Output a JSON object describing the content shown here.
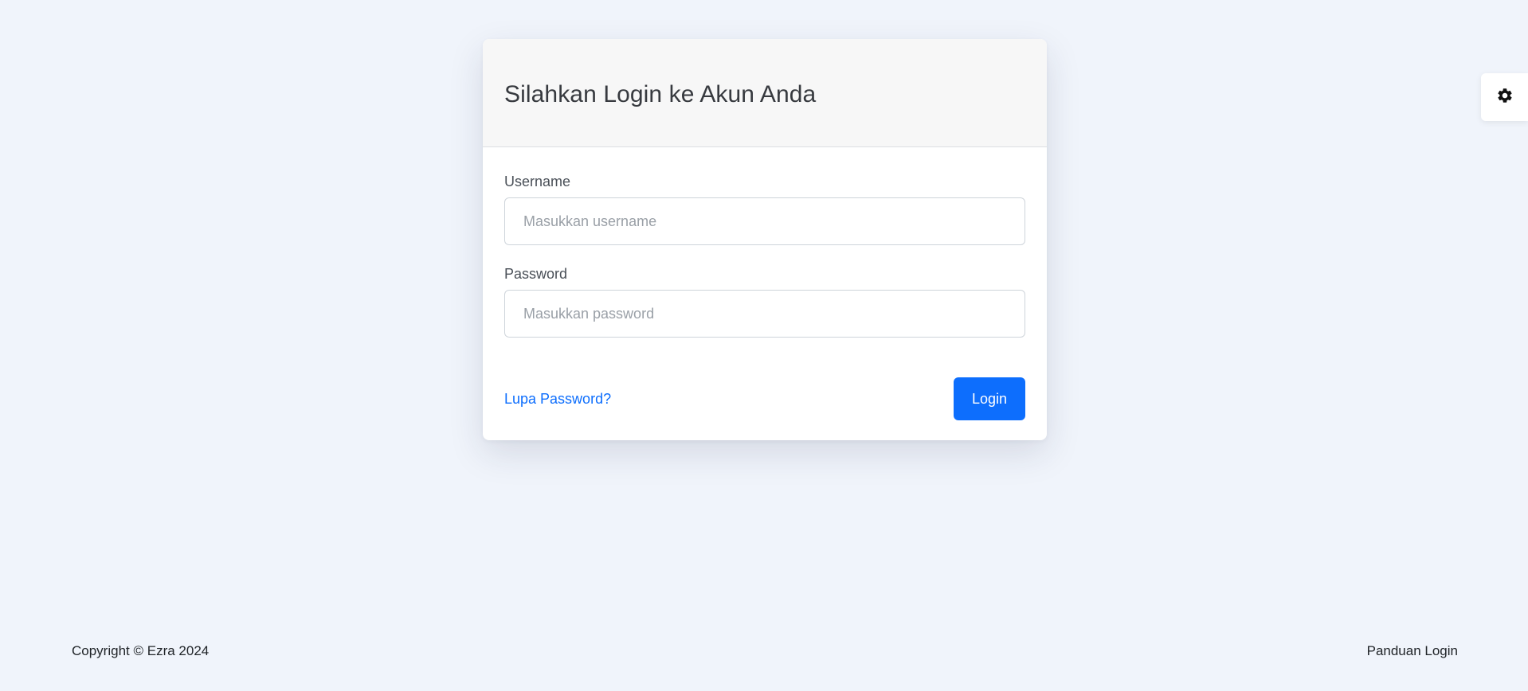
{
  "login_card": {
    "title": "Silahkan Login ke Akun Anda",
    "username": {
      "label": "Username",
      "placeholder": "Masukkan username",
      "value": ""
    },
    "password": {
      "label": "Password",
      "placeholder": "Masukkan password",
      "value": ""
    },
    "forgot_password_label": "Lupa Password?",
    "login_button_label": "Login"
  },
  "settings": {
    "icon": "gear-icon"
  },
  "footer": {
    "copyright": "Copyright © Ezra 2024",
    "guide_link": "Panduan Login"
  },
  "colors": {
    "background": "#f0f4fb",
    "primary": "#0d6efd",
    "card_header": "#f7f7f7"
  }
}
